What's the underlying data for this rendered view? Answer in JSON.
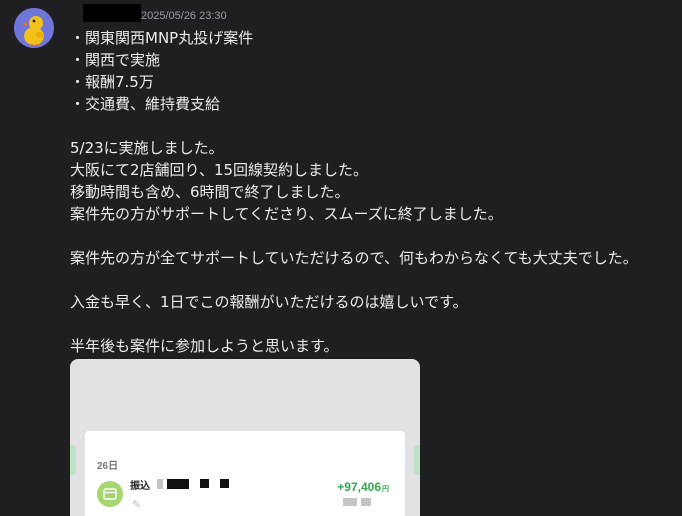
{
  "post": {
    "timestamp": "2025/05/26 23:30"
  },
  "message": {
    "bullets": [
      "・関東関西MNP丸投げ案件",
      "・関西で実施",
      "・報酬7.5万",
      "・交通費、維持費支給"
    ],
    "para1": [
      "5/23に実施しました。",
      "大阪にて2店舗回り、15回線契約しました。",
      "移動時間も含め、6時間で終了しました。",
      "案件先の方がサポートしてくださり、スムーズに終了しました。"
    ],
    "para2": "案件先の方が全てサポートしていただけるので、何もわからなくても大丈夫でした。",
    "para3": "入金も早く、1日でこの報酬がいただけるのは嬉しいです。",
    "para4": "半年後も案件に参加しようと思います。"
  },
  "attachment": {
    "date": "26日",
    "label": "振込",
    "amount": "+97,406",
    "currency": "円"
  },
  "icons": {
    "avatar": "duck-avatar-icon",
    "card": "wallet-icon",
    "pencil": "pencil-icon"
  },
  "colors": {
    "background": "#1f1f22",
    "text": "#ececef",
    "timestamp": "#9a9aa2",
    "avatar_bg": "#6f76d8",
    "amount": "#2fa84f"
  }
}
